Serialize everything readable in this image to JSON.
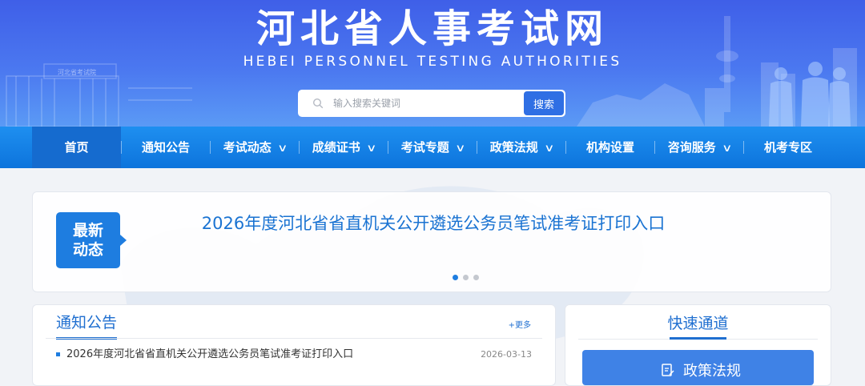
{
  "header": {
    "title": "河北省人事考试网",
    "subtitle": "HEBEI PERSONNEL TESTING AUTHORITIES",
    "gate_sign": "河北省考试院"
  },
  "search": {
    "placeholder": "输入搜索关键词",
    "value": "",
    "button_label": "搜索"
  },
  "nav": {
    "items": [
      {
        "label": "首页",
        "has_dropdown": false,
        "active": true
      },
      {
        "label": "通知公告",
        "has_dropdown": false
      },
      {
        "label": "考试动态",
        "has_dropdown": true
      },
      {
        "label": "成绩证书",
        "has_dropdown": true
      },
      {
        "label": "考试专题",
        "has_dropdown": true
      },
      {
        "label": "政策法规",
        "has_dropdown": true
      },
      {
        "label": "机构设置",
        "has_dropdown": false
      },
      {
        "label": "咨询服务",
        "has_dropdown": true
      },
      {
        "label": "机考专区",
        "has_dropdown": false
      }
    ],
    "dropdown_glyph": "∨"
  },
  "latest": {
    "badge_line1": "最新",
    "badge_line2": "动态",
    "headline": "2026年度河北省省直机关公开遴选公务员笔试准考证打印入口",
    "slide_count": 3,
    "active_slide": 1
  },
  "notices": {
    "title": "通知公告",
    "more_label": "+更多",
    "items": [
      {
        "title": "2026年度河北省省直机关公开遴选公务员笔试准考证打印入口",
        "date": "2026-03-13"
      }
    ]
  },
  "quick": {
    "title": "快速通道",
    "buttons": [
      {
        "label": "政策法规",
        "icon": "document-edit-icon"
      }
    ]
  },
  "colors": {
    "header_top": "#3f5fe8",
    "header_bottom": "#5b9af5",
    "nav_bg": "#0d74dc",
    "nav_active": "#156bcf",
    "accent": "#1f6fd0",
    "badge": "#1e7de0",
    "quick_button": "#3f82e6"
  }
}
